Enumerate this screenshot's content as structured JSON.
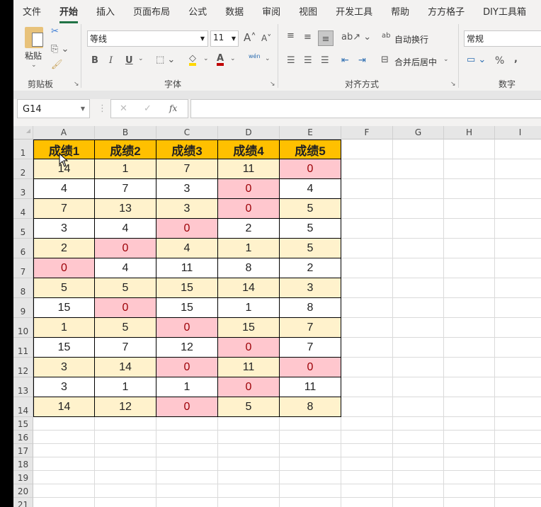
{
  "tabs": [
    "文件",
    "开始",
    "插入",
    "页面布局",
    "公式",
    "数据",
    "审阅",
    "视图",
    "开发工具",
    "帮助",
    "方方格子",
    "DIY工具箱"
  ],
  "active_tab": 1,
  "ribbon": {
    "paste": "粘贴",
    "clipboard_group": "剪贴板",
    "font_name": "等线",
    "font_size": "11",
    "font_group": "字体",
    "bold": "B",
    "italic": "I",
    "underline": "U",
    "phonetic": "wén",
    "wrap_text": "自动换行",
    "merge_center": "合并后居中",
    "align_group": "对齐方式",
    "number_format": "常规",
    "percent": "%",
    "comma": ",",
    "number_group": "数字"
  },
  "formula_bar": {
    "name_box": "G14",
    "fx": "fx",
    "value": ""
  },
  "columns": [
    "A",
    "B",
    "C",
    "D",
    "E",
    "F",
    "G",
    "H",
    "I"
  ],
  "rows": [
    "1",
    "2",
    "3",
    "4",
    "5",
    "6",
    "7",
    "8",
    "9",
    "10",
    "11",
    "12",
    "13",
    "14",
    "15",
    "16",
    "17",
    "18",
    "19",
    "20",
    "21"
  ],
  "table": {
    "headers": [
      "成绩1",
      "成绩2",
      "成绩3",
      "成绩4",
      "成绩5"
    ],
    "values": [
      [
        14,
        1,
        7,
        11,
        0
      ],
      [
        4,
        7,
        3,
        0,
        4
      ],
      [
        7,
        13,
        3,
        0,
        5
      ],
      [
        3,
        4,
        0,
        2,
        5
      ],
      [
        2,
        0,
        4,
        1,
        5
      ],
      [
        0,
        4,
        11,
        8,
        2
      ],
      [
        5,
        5,
        15,
        14,
        3
      ],
      [
        15,
        0,
        15,
        1,
        8
      ],
      [
        1,
        5,
        0,
        15,
        7
      ],
      [
        15,
        7,
        12,
        0,
        7
      ],
      [
        3,
        14,
        0,
        11,
        0
      ],
      [
        3,
        1,
        1,
        0,
        11
      ],
      [
        14,
        12,
        0,
        5,
        8
      ]
    ]
  },
  "colors": {
    "header_fill": "#ffc000",
    "band_fill": "#fff2cc",
    "zero_fill": "#ffc7ce",
    "zero_text": "#9c0006",
    "accent": "#217346"
  }
}
